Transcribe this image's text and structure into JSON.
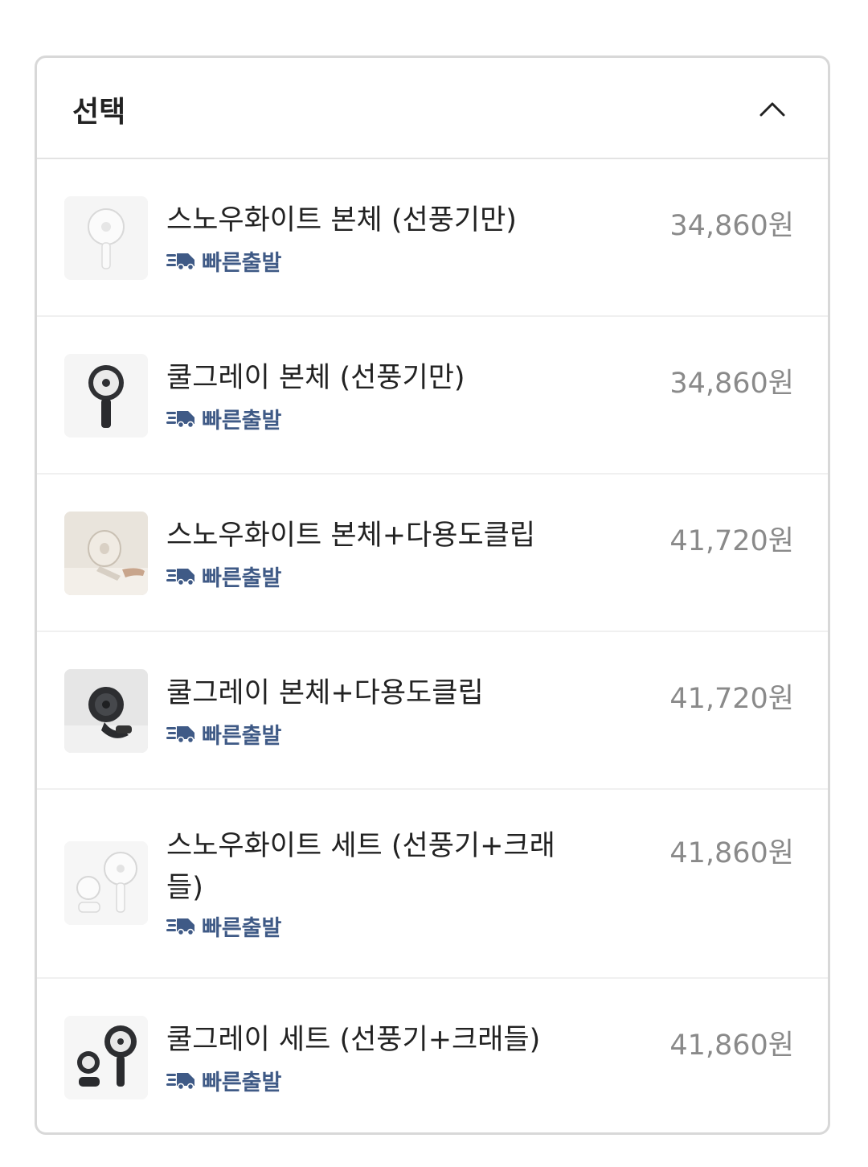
{
  "dropdown": {
    "title": "선택",
    "toggle_icon": "chevron-up-icon"
  },
  "badge_icon": "fast-delivery-truck-icon",
  "colors": {
    "badge": "#3f5a86",
    "price": "#8a8a8a",
    "text": "#222222",
    "border": "#d8d8d8"
  },
  "options": [
    {
      "name": "스노우화이트 본체 (선풍기만)",
      "price": "34,860원",
      "badge": "빠른출발",
      "thumb": "white-fan"
    },
    {
      "name": "쿨그레이 본체 (선풍기만)",
      "price": "34,860원",
      "badge": "빠른출발",
      "thumb": "gray-fan"
    },
    {
      "name": "스노우화이트 본체+다용도클립",
      "price": "41,720원",
      "badge": "빠른출발",
      "thumb": "white-fan-clip"
    },
    {
      "name": "쿨그레이 본체+다용도클립",
      "price": "41,720원",
      "badge": "빠른출발",
      "thumb": "gray-fan-clip"
    },
    {
      "name": "스노우화이트 세트 (선풍기+크래들)",
      "price": "41,860원",
      "badge": "빠른출발",
      "thumb": "white-fan-set"
    },
    {
      "name": "쿨그레이 세트 (선풍기+크래들)",
      "price": "41,860원",
      "badge": "빠른출발",
      "thumb": "gray-fan-set"
    }
  ]
}
